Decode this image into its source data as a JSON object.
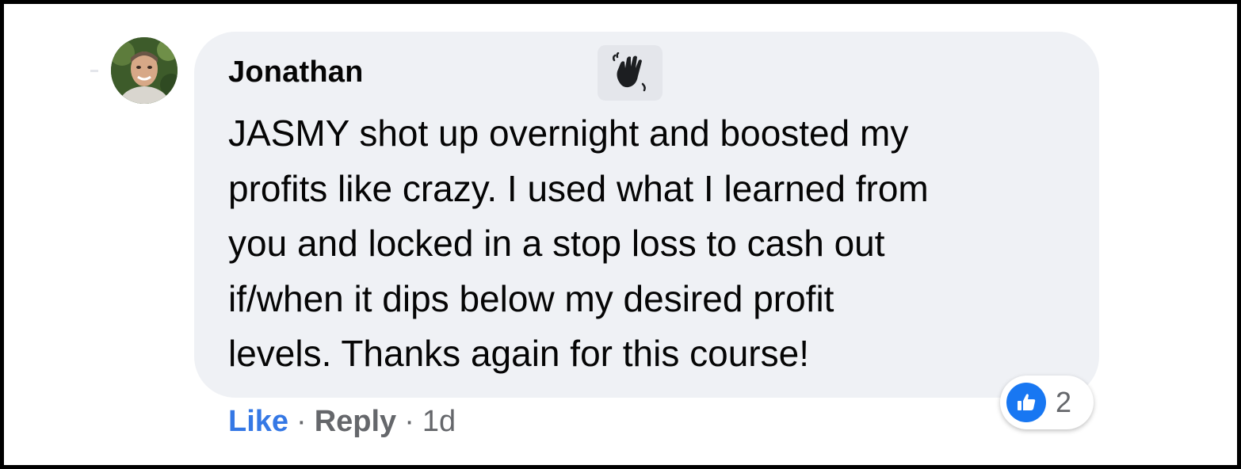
{
  "comment": {
    "author": "Jonathan",
    "text_lines": [
      "JASMY shot up overnight and boosted my",
      "profits like crazy. I used what I learned from",
      "you and locked in a stop loss to cash out",
      "if/when it dips below my desired profit",
      "levels. Thanks again for this course!"
    ],
    "badge_icon": "waving-hand-icon",
    "avatar_icon": "profile-photo"
  },
  "actions": {
    "like_label": "Like",
    "separator": "·",
    "reply_label": "Reply",
    "timestamp": "1d"
  },
  "reactions": {
    "icon": "thumbs-up-icon",
    "count": "2"
  },
  "colors": {
    "bubble_bg": "#eff1f5",
    "like_blue": "#3578e5",
    "reaction_blue": "#1877f2",
    "meta_gray": "#65676b"
  }
}
